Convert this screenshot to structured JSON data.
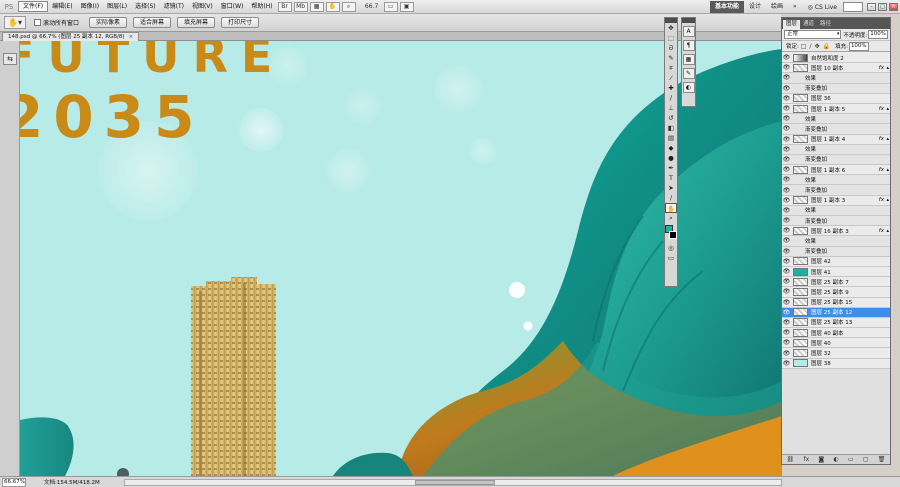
{
  "app": {
    "logo": "PS",
    "menus": [
      "文件(F)",
      "编辑(E)",
      "图像(I)",
      "图层(L)",
      "选择(S)",
      "滤镜(T)",
      "视图(V)",
      "窗口(W)",
      "帮助(H)"
    ],
    "zoom_level": "66.7",
    "workspaces": {
      "basic": "基本功能",
      "design": "设计",
      "draw": "绘画",
      "more": "»"
    },
    "cs_live": "CS Live"
  },
  "options_bar": {
    "scroll_all_label": "滚动所有窗口",
    "buttons": [
      "实际像素",
      "适合屏幕",
      "填充屏幕",
      "打印尺寸"
    ]
  },
  "document": {
    "tab_title": "148.psd @ 66.7% (图层 25 副本 12, RGB/8)",
    "close_glyph": "×",
    "headline_1": "FUTURE",
    "headline_2": "2035"
  },
  "layers_panel": {
    "tabs": [
      "图层",
      "通道",
      "路径"
    ],
    "blend_mode": "正常",
    "opacity_label": "不透明度:",
    "opacity_value": "100%",
    "lock_label": "锁定:",
    "fill_label": "填充:",
    "fill_value": "100%",
    "layers": [
      {
        "name": "自然饱和度 2",
        "type": "adj"
      },
      {
        "name": "图层 10 副本",
        "type": "check",
        "fx": true
      },
      {
        "name": "效果",
        "type": "sub"
      },
      {
        "name": "渐变叠加",
        "type": "sub"
      },
      {
        "name": "图层 36",
        "type": "check"
      },
      {
        "name": "图层 1 副本 5",
        "type": "check",
        "fx": true
      },
      {
        "name": "效果",
        "type": "sub"
      },
      {
        "name": "渐变叠加",
        "type": "sub"
      },
      {
        "name": "图层 1 副本 4",
        "type": "check",
        "fx": true
      },
      {
        "name": "效果",
        "type": "sub"
      },
      {
        "name": "渐变叠加",
        "type": "sub"
      },
      {
        "name": "图层 1 副本 6",
        "type": "check",
        "fx": true
      },
      {
        "name": "效果",
        "type": "sub"
      },
      {
        "name": "渐变叠加",
        "type": "sub"
      },
      {
        "name": "图层 1 副本 3",
        "type": "check",
        "fx": true
      },
      {
        "name": "效果",
        "type": "sub"
      },
      {
        "name": "渐变叠加",
        "type": "sub"
      },
      {
        "name": "图层 16 副本 3",
        "type": "check",
        "fx": true
      },
      {
        "name": "效果",
        "type": "sub"
      },
      {
        "name": "渐变叠加",
        "type": "sub"
      },
      {
        "name": "图层 42",
        "type": "check"
      },
      {
        "name": "图层 41",
        "type": "teal"
      },
      {
        "name": "图层 25 副本 7",
        "type": "check"
      },
      {
        "name": "图层 25 副本 9",
        "type": "check"
      },
      {
        "name": "图层 25 副本 15",
        "type": "check"
      },
      {
        "name": "图层 25 副本 12",
        "type": "check",
        "selected": true
      },
      {
        "name": "图层 25 副本 13",
        "type": "check"
      },
      {
        "name": "图层 40 副本",
        "type": "check"
      },
      {
        "name": "图层 40",
        "type": "check"
      },
      {
        "name": "图层 32",
        "type": "check"
      },
      {
        "name": "图层 38",
        "type": "plain"
      }
    ]
  },
  "status_bar": {
    "zoom": "66.67%",
    "doc_info": "文档:154.5M/418.2M"
  },
  "colors": {
    "foreground": "#19b3a4",
    "background": "#000000",
    "canvas_bg": "#b6ebe7",
    "headline": "#c98a18",
    "selected_layer": "#3d8ee6"
  }
}
